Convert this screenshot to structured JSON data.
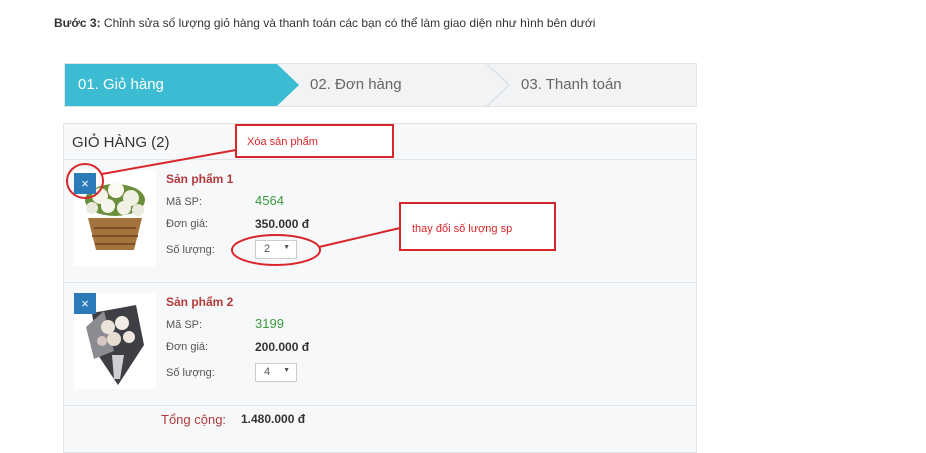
{
  "intro": {
    "step": "Bước 3:",
    "text": " Chỉnh sửa số lượng giỏ hàng và thanh toán các bạn có thể làm giao diện như hình bên dưới"
  },
  "steps": [
    {
      "label": "01. Giỏ hàng",
      "active": true
    },
    {
      "label": "02. Đơn hàng",
      "active": false
    },
    {
      "label": "03. Thanh toán",
      "active": false
    }
  ],
  "colors": {
    "active_step": "#3bbcd3",
    "remove_button": "#2b7bb9",
    "annotation": "#d9262b",
    "product_name": "#b23a3a",
    "code": "#3c9a3c"
  },
  "cart": {
    "title": "GIỎ HÀNG (2)",
    "labels": {
      "code": "Mã SP:",
      "price": "Đơn giá:",
      "qty": "Số lượng:"
    },
    "items": [
      {
        "name": "Sản phẩm 1",
        "code": "4564",
        "price": "350.000 đ",
        "qty": "2",
        "image": "flower-basket"
      },
      {
        "name": "Sản phẩm 2",
        "code": "3199",
        "price": "200.000 đ",
        "qty": "4",
        "image": "flower-bouquet"
      }
    ],
    "remove_icon": "×",
    "qty_arrow": "▼",
    "total_label": "Tổng cộng:",
    "total_value": "1.480.000 đ"
  },
  "annotations": {
    "delete": "Xóa sản phẩm",
    "qty": "thay đổi số lượng sp"
  }
}
